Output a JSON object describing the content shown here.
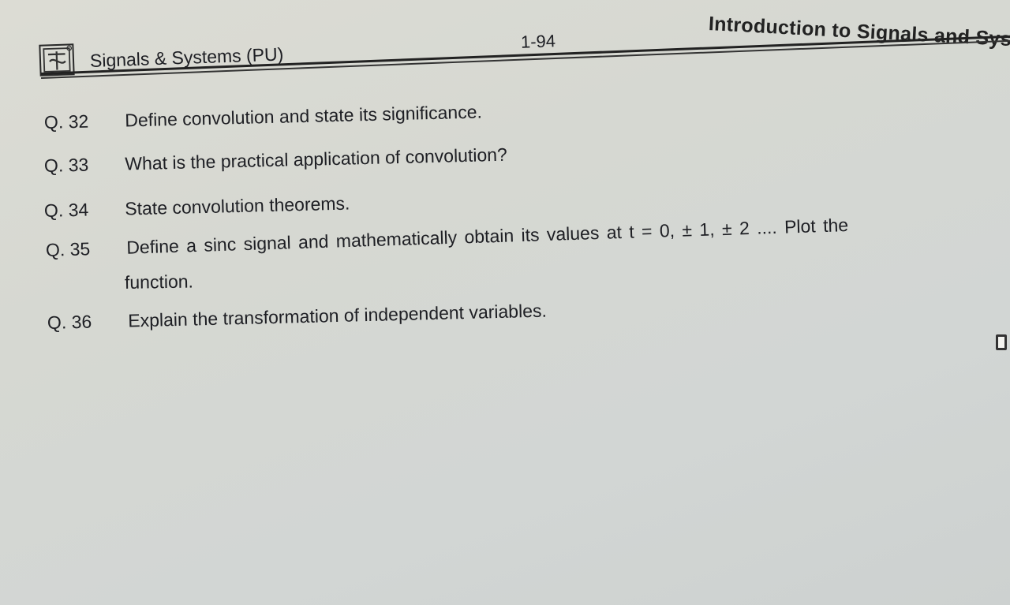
{
  "header": {
    "book_title": "Signals & Systems (PU)",
    "page_number": "1-94",
    "chapter_title": "Introduction to Signals and Sys"
  },
  "questions": [
    {
      "number": "Q. 32",
      "text": "Define convolution and state its significance."
    },
    {
      "number": "Q. 33",
      "text": "What is the practical application of convolution?"
    },
    {
      "number": "Q. 34",
      "text": "State convolution theorems."
    },
    {
      "number": "Q. 35",
      "text": "Define a sinc signal and mathematically obtain its values at t = 0, ± 1, ± 2 .... Plot the",
      "continuation": "function."
    },
    {
      "number": "Q. 36",
      "text": "Explain the transformation of independent variables."
    }
  ]
}
